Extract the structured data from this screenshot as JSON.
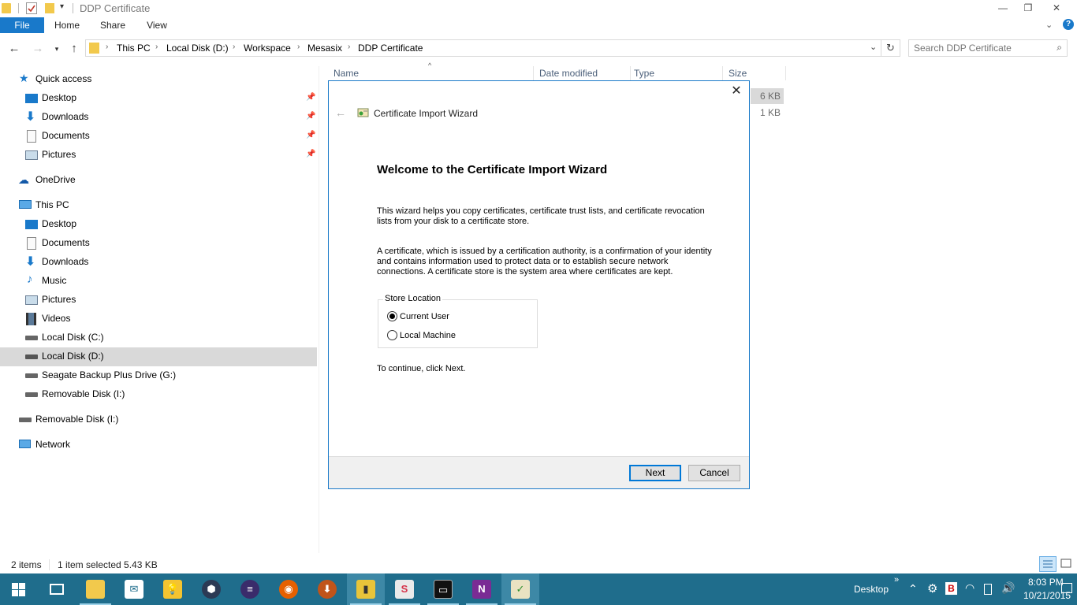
{
  "window": {
    "title": "DDP Certificate",
    "controls": {
      "minimize": "—",
      "maximize": "❐",
      "close": "✕"
    }
  },
  "ribbon": {
    "tabs": [
      "File",
      "Home",
      "Share",
      "View"
    ],
    "expand_icon": "chevron-down-icon",
    "help_icon": "help-icon"
  },
  "address": {
    "crumbs": [
      "This PC",
      "Local Disk (D:)",
      "Workspace",
      "Mesasix",
      "DDP Certificate"
    ],
    "search_placeholder": "Search DDP Certificate"
  },
  "nav": {
    "quick_access": "Quick access",
    "quick_items": [
      "Desktop",
      "Downloads",
      "Documents",
      "Pictures"
    ],
    "onedrive": "OneDrive",
    "this_pc": "This PC",
    "pc_items": [
      "Desktop",
      "Documents",
      "Downloads",
      "Music",
      "Pictures",
      "Videos",
      "Local Disk (C:)",
      "Local Disk (D:)",
      "Seagate Backup Plus Drive (G:)",
      "Removable Disk (I:)"
    ],
    "removable": "Removable Disk (I:)",
    "network": "Network",
    "selected": "Local Disk (D:)"
  },
  "filelist": {
    "columns": [
      "Name",
      "Date modified",
      "Type",
      "Size"
    ],
    "sizes": [
      "6 KB",
      "1 KB"
    ]
  },
  "dialog": {
    "window_title": "Certificate Import Wizard",
    "heading": "Welcome to the Certificate Import Wizard",
    "para1_line1": "This wizard helps you copy certificates, certificate trust lists, and certificate revocation",
    "para1_line2": "lists from your disk to a certificate store.",
    "para2_line1": "A certificate, which is issued by a certification authority, is a confirmation of your identity",
    "para2_line2": "and contains information used to protect data or to establish secure network",
    "para2_line3": "connections. A certificate store is the system area where certificates are kept.",
    "store_location_label": "Store Location",
    "options": [
      "Current User",
      "Local Machine"
    ],
    "selected_option": "Current User",
    "continue_text": "To continue, click Next.",
    "next_label": "Next",
    "cancel_label": "Cancel"
  },
  "status": {
    "item_count": "2 items",
    "selection": "1 item selected  5.43 KB"
  },
  "taskbar": {
    "desktop_label": "Desktop",
    "time": "8:03 PM",
    "date": "10/21/2015",
    "chevron": "»"
  },
  "colors": {
    "accent": "#1979ca",
    "taskbar": "#1f6d8c",
    "dialog_border": "#1c7bc9",
    "selection": "#d9d9d9"
  }
}
